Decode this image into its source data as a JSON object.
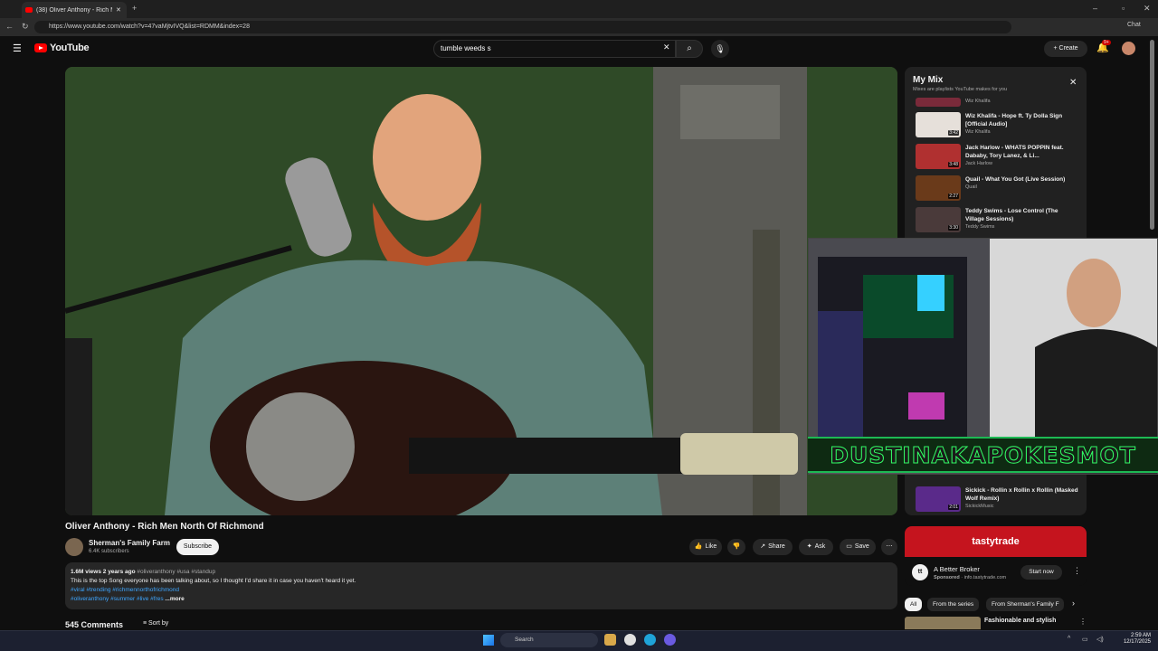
{
  "browser": {
    "tab_title": "(38) Oliver Anthony - Rich Me",
    "url": "https://www.youtube.com/watch?v=47vaMjtvIVQ&list=RDMM&index=28",
    "chat_label": "Chat"
  },
  "header": {
    "logo_text": "YouTube",
    "search_value": "tumble weeds s",
    "create_label": "Create",
    "notification_count": "9+"
  },
  "video": {
    "title": "Oliver Anthony - Rich Men North Of Richmond",
    "channel": "Sherman's Family Farm",
    "subscribers": "6.4K subscribers",
    "subscribe_label": "Subscribe",
    "actions": {
      "like": "Like",
      "share": "Share",
      "ask": "Ask",
      "save": "Save"
    },
    "description": {
      "meta": "1.6M views  2 years ago",
      "meta_tags": "#oliveranthony #usa #standup",
      "line1": "This is the top Song everyone has been talking about, so I thought I'd share it in case you haven't heard it yet.",
      "line2": "#viral #trending #richmennorthofrichmond",
      "line3": "#oliveranthony #summer #live #fres",
      "more": "...more"
    },
    "comments_count": "545 Comments",
    "sort_label": "Sort by"
  },
  "mix": {
    "title": "My Mix",
    "subtitle": "Mixes are playlists YouTube makes for you",
    "items": [
      {
        "title": "",
        "channel": "Wiz Khalifa",
        "duration": ""
      },
      {
        "title": "Wiz Khalifa - Hope ft. Ty Dolla Sign [Official Audio]",
        "channel": "Wiz Khalifa",
        "duration": "3:42"
      },
      {
        "title": "Jack Harlow - WHATS POPPIN feat. Dababy, Tory Lanez, & Li...",
        "channel": "Jack Harlow",
        "duration": "3:48"
      },
      {
        "title": "Quail - What You Got (Live Session)",
        "channel": "Quail",
        "duration": "2:27"
      },
      {
        "title": "Teddy Swims - Lose Control (The Village Sessions)",
        "channel": "Teddy Swims",
        "duration": "3:30"
      },
      {
        "title": "Sickick - Rollin x Rollin x Rollin (Masked Wolf Remix)",
        "channel": "SickickMusic",
        "duration": "2:01"
      }
    ]
  },
  "overlay": {
    "banner_text": "DUSTINAKAPOKESMOT"
  },
  "ad": {
    "brand": "tastytrade",
    "title": "A Better Broker",
    "sponsored": "Sponsored",
    "domain": "info.tastytrade.com",
    "cta": "Start now"
  },
  "chips": [
    "All",
    "From the series",
    "From Sherman's Family F"
  ],
  "next_video": {
    "title": "Fashionable and stylish"
  },
  "taskbar": {
    "search_label": "Search",
    "time": "2:59 AM",
    "date": "12/17/2025"
  }
}
